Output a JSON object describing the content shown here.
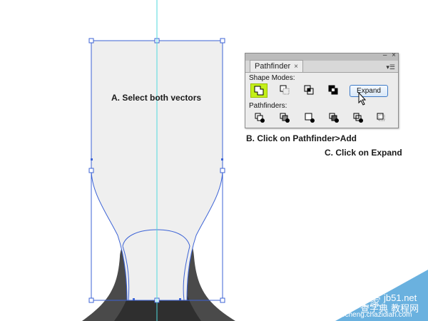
{
  "annotations": {
    "a": "A. Select both vectors",
    "b": "B. Click on Pathfinder>Add",
    "c": "C. Click on Expand"
  },
  "pathfinder_panel": {
    "tab_label": "Pathfinder",
    "tab_close": "×",
    "minimize": "–",
    "close": "×",
    "menu": "▾☰",
    "shape_modes_label": "Shape Modes:",
    "pathfinders_label": "Pathfinders:",
    "expand_label": "Expand",
    "shape_modes": [
      "unite-icon",
      "minus-front-icon",
      "intersect-icon",
      "exclude-icon"
    ],
    "pathfinders": [
      "divide-icon",
      "trim-icon",
      "merge-icon",
      "crop-icon",
      "outline-icon",
      "minus-back-icon"
    ]
  },
  "watermark": {
    "site": "jb51.net",
    "brand": "脚本之家",
    "sub": "jiaocheng.chazidian.com",
    "cn": "查字典 教程网"
  },
  "colors": {
    "selection": "#3c63d6",
    "guide": "#4fd8dc",
    "shape_fill": "#efefef",
    "dark_shape": "#4a4a4a",
    "darker_shape": "#2f2f2f",
    "active_mode": "#c4f01a"
  }
}
